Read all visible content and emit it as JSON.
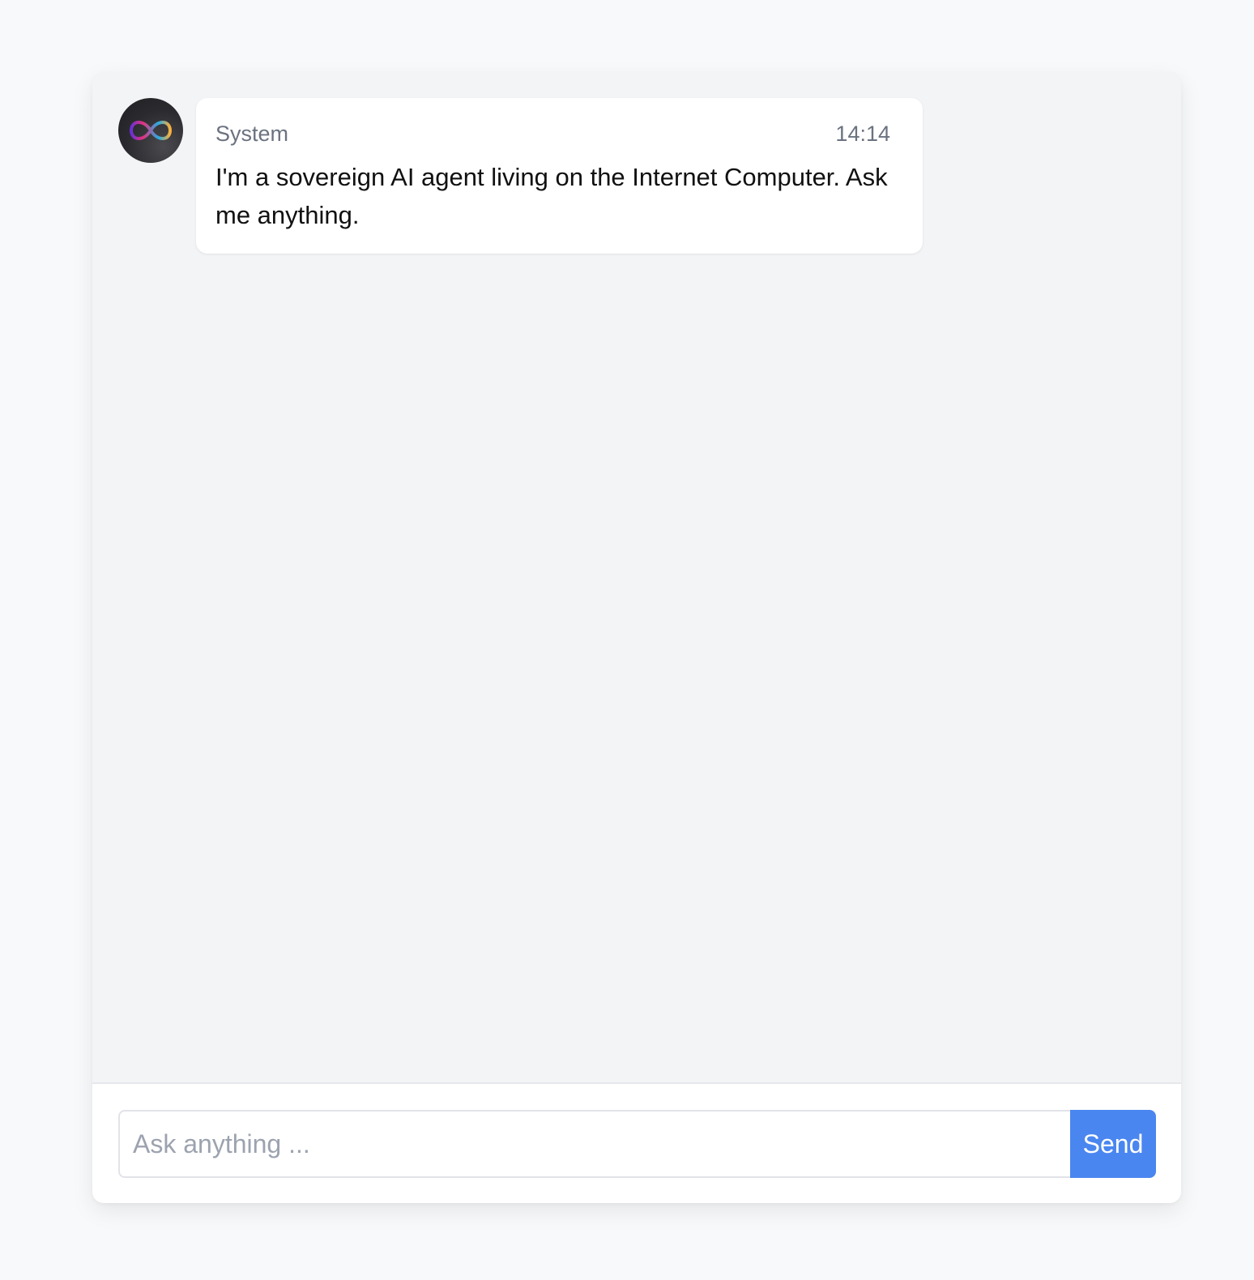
{
  "messages": [
    {
      "author": "System",
      "time": "14:14",
      "text": "I'm a sovereign AI agent living on the Internet Computer. Ask me anything.",
      "avatar_icon": "infinity-logo-icon"
    }
  ],
  "composer": {
    "placeholder": "Ask anything ...",
    "value": "",
    "send_label": "Send"
  },
  "colors": {
    "accent": "#4a86f0",
    "page_background": "#f8f9fb",
    "chat_background": "#f3f4f6"
  }
}
